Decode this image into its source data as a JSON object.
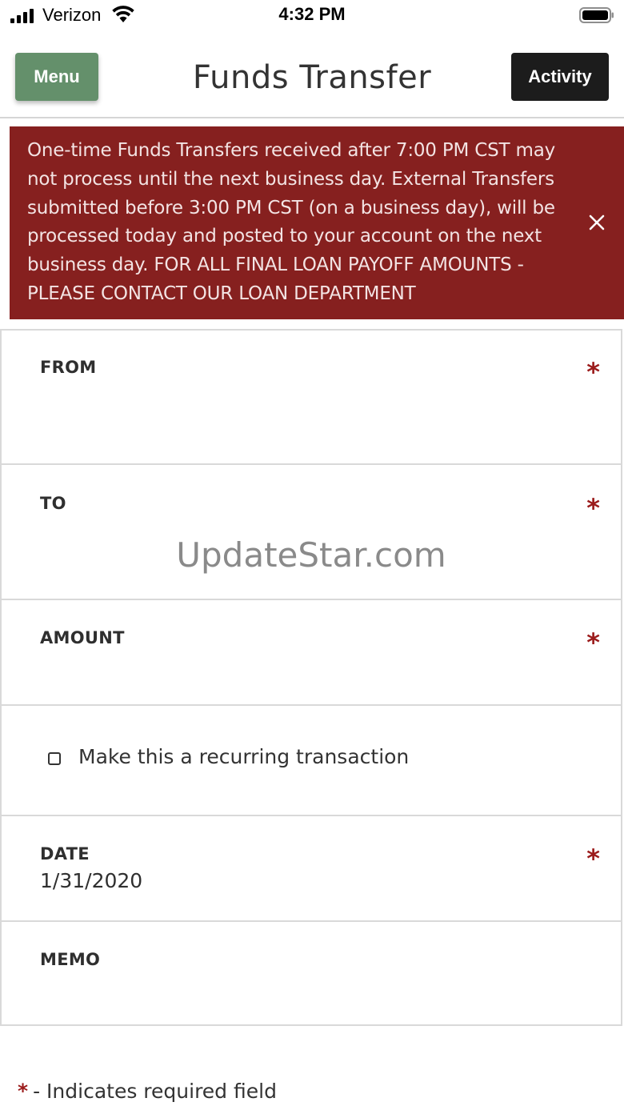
{
  "status_bar": {
    "carrier": "Verizon",
    "time": "4:32 PM",
    "icons": [
      "signal-icon",
      "wifi-icon",
      "battery-icon"
    ]
  },
  "header": {
    "menu_label": "Menu",
    "title": "Funds Transfer",
    "activity_label": "Activity"
  },
  "alert": {
    "message": "One-time Funds Transfers received after 7:00 PM CST may not process until the next business day. External Transfers submitted before 3:00 PM CST (on a business day), will be processed today and posted to your account on the next business day. FOR ALL FINAL LOAN PAYOFF AMOUNTS - PLEASE CONTACT OUR LOAN DEPARTMENT",
    "close_icon": "close-icon"
  },
  "form": {
    "from": {
      "label": "FROM",
      "required": "*",
      "value": ""
    },
    "to": {
      "label": "TO",
      "required": "*",
      "value": ""
    },
    "amount": {
      "label": "AMOUNT",
      "required": "*",
      "value": ""
    },
    "recurring": {
      "label": "Make this a recurring transaction",
      "checked": false
    },
    "date": {
      "label": "DATE",
      "required": "*",
      "value": "1/31/2020"
    },
    "memo": {
      "label": "MEMO",
      "value": ""
    }
  },
  "watermark": "UpdateStar.com",
  "footer": {
    "star": "*",
    "note": "- Indicates required field"
  },
  "colors": {
    "menu_button": "#64906b",
    "activity_button": "#1c1c1c",
    "alert_background": "#86201f",
    "required_star": "#9b1b1b"
  }
}
